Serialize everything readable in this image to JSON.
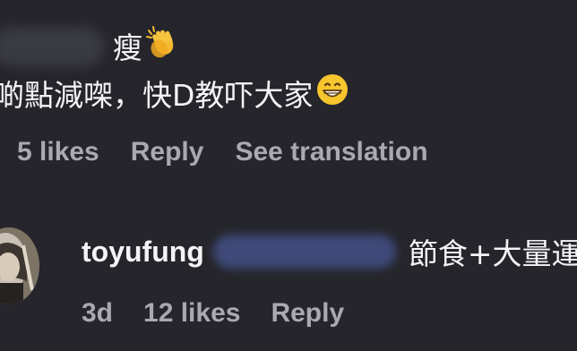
{
  "comment_1": {
    "text_line_1": "瘦",
    "text_line_1_emoji": "clapping-hands-icon",
    "text_line_2": "啲點減㗎，快D教吓大家",
    "text_line_2_emoji": "grinning-face-icon",
    "actions": {
      "likes": "5 likes",
      "reply": "Reply",
      "see_translation": "See translation"
    }
  },
  "comment_2": {
    "username": "toyufung",
    "text": "節食+大量運",
    "actions": {
      "time": "3d",
      "likes": "12 likes",
      "reply": "Reply"
    }
  },
  "colors": {
    "background": "#25252b",
    "primary_text": "#f4f4f6",
    "secondary_text": "#a9a9b2",
    "mention_blur": "#3f4a7a"
  }
}
